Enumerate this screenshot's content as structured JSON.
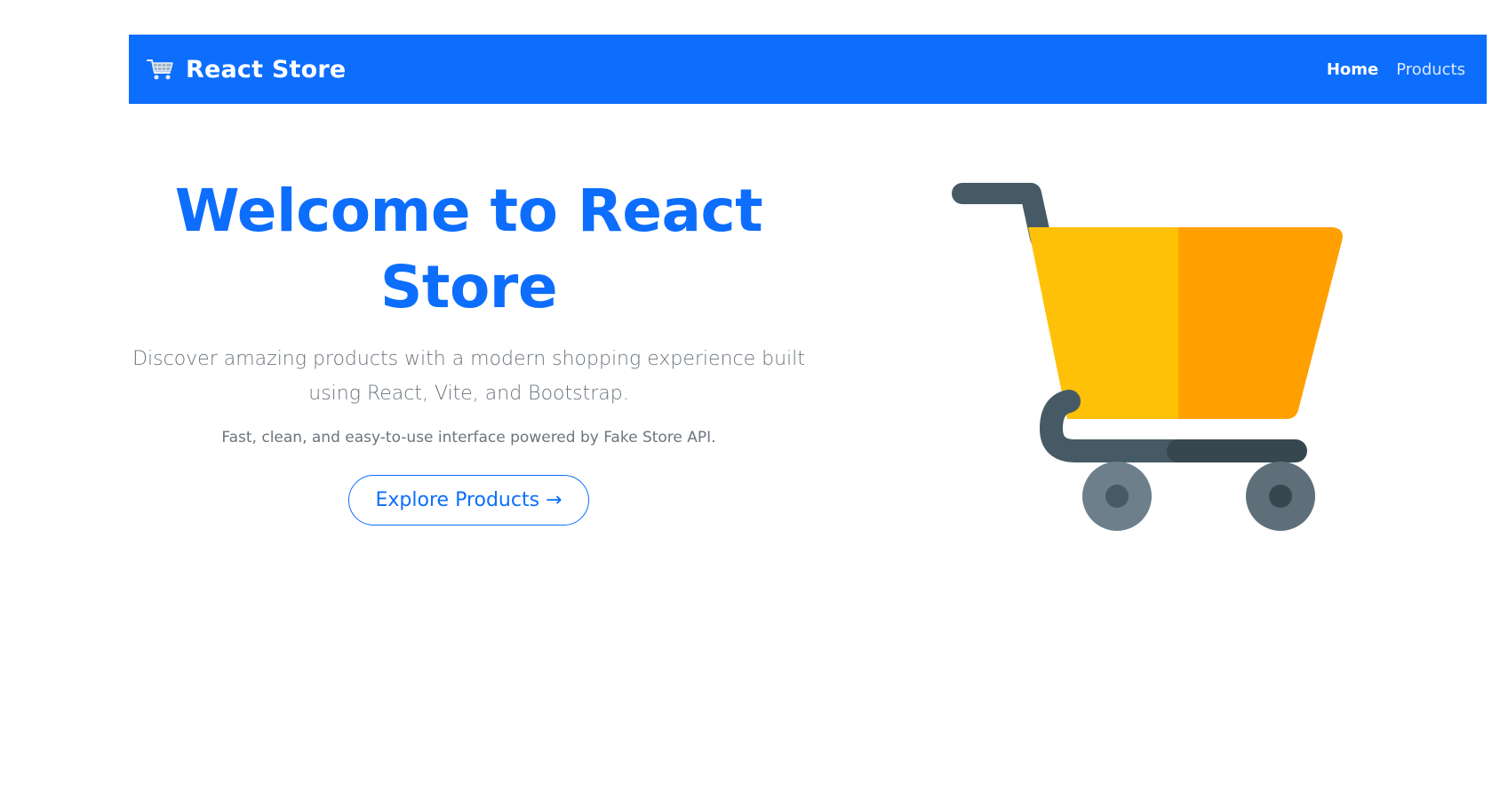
{
  "navbar": {
    "brand_icon": "shopping-cart-icon",
    "brand_label": "React Store",
    "links": [
      {
        "label": "Home",
        "active": true
      },
      {
        "label": "Products",
        "active": false
      }
    ],
    "background_color": "#0d6efd"
  },
  "hero": {
    "title": "Welcome to React Store",
    "lead": "Discover amazing products with a modern shopping experience built using React, Vite, and Bootstrap.",
    "subtext": "Fast, clean, and easy-to-use interface powered by Fake Store API.",
    "cta_label": "Explore Products →",
    "accent_color": "#0d6efd"
  },
  "illustration": {
    "icon": "shopping-cart-illustration",
    "colors": {
      "basket_left": "#ffc107",
      "basket_right": "#ffa000",
      "frame": "#455a64",
      "wheel": "#607d8b"
    }
  }
}
